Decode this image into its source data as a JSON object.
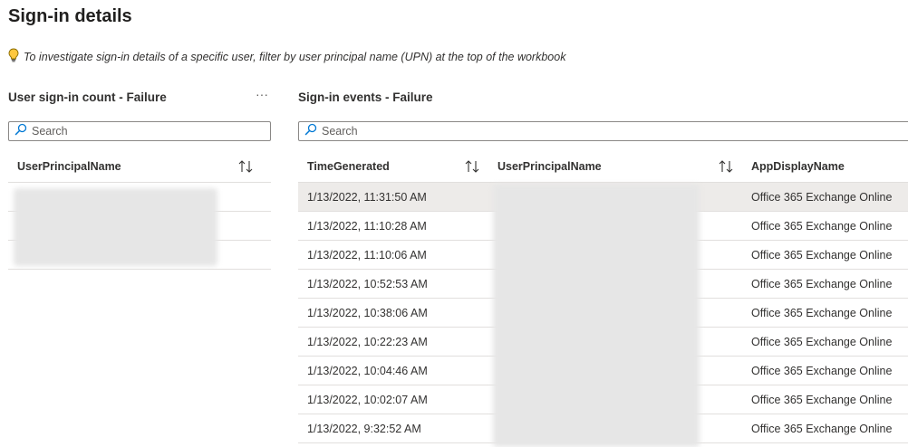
{
  "page": {
    "title": "Sign-in details",
    "info_text": "To investigate sign-in details of a specific user, filter by user principal name (UPN) at the top of the workbook",
    "info_icon": "lightbulb-icon"
  },
  "left_panel": {
    "title": "User sign-in count - Failure",
    "more_icon": "more-options-icon",
    "more_glyph": "···",
    "search_placeholder": "Search",
    "columns": [
      "UserPrincipalName"
    ],
    "row_count": 3
  },
  "right_panel": {
    "title": "Sign-in events - Failure",
    "search_placeholder": "Search",
    "columns": [
      "TimeGenerated",
      "UserPrincipalName",
      "AppDisplayName"
    ],
    "rows": [
      {
        "time": "1/13/2022, 11:31:50 AM",
        "app": "Office 365 Exchange Online"
      },
      {
        "time": "1/13/2022, 11:10:28 AM",
        "app": "Office 365 Exchange Online"
      },
      {
        "time": "1/13/2022, 11:10:06 AM",
        "app": "Office 365 Exchange Online"
      },
      {
        "time": "1/13/2022, 10:52:53 AM",
        "app": "Office 365 Exchange Online"
      },
      {
        "time": "1/13/2022, 10:38:06 AM",
        "app": "Office 365 Exchange Online"
      },
      {
        "time": "1/13/2022, 10:22:23 AM",
        "app": "Office 365 Exchange Online"
      },
      {
        "time": "1/13/2022, 10:04:46 AM",
        "app": "Office 365 Exchange Online"
      },
      {
        "time": "1/13/2022, 10:02:07 AM",
        "app": "Office 365 Exchange Online"
      },
      {
        "time": "1/13/2022, 9:32:52 AM",
        "app": "Office 365 Exchange Online"
      }
    ]
  },
  "colors": {
    "selected_row": "#edebe9",
    "border": "#e1dfdd",
    "search_icon": "#0078d4",
    "bulb": "#ffc83d"
  }
}
